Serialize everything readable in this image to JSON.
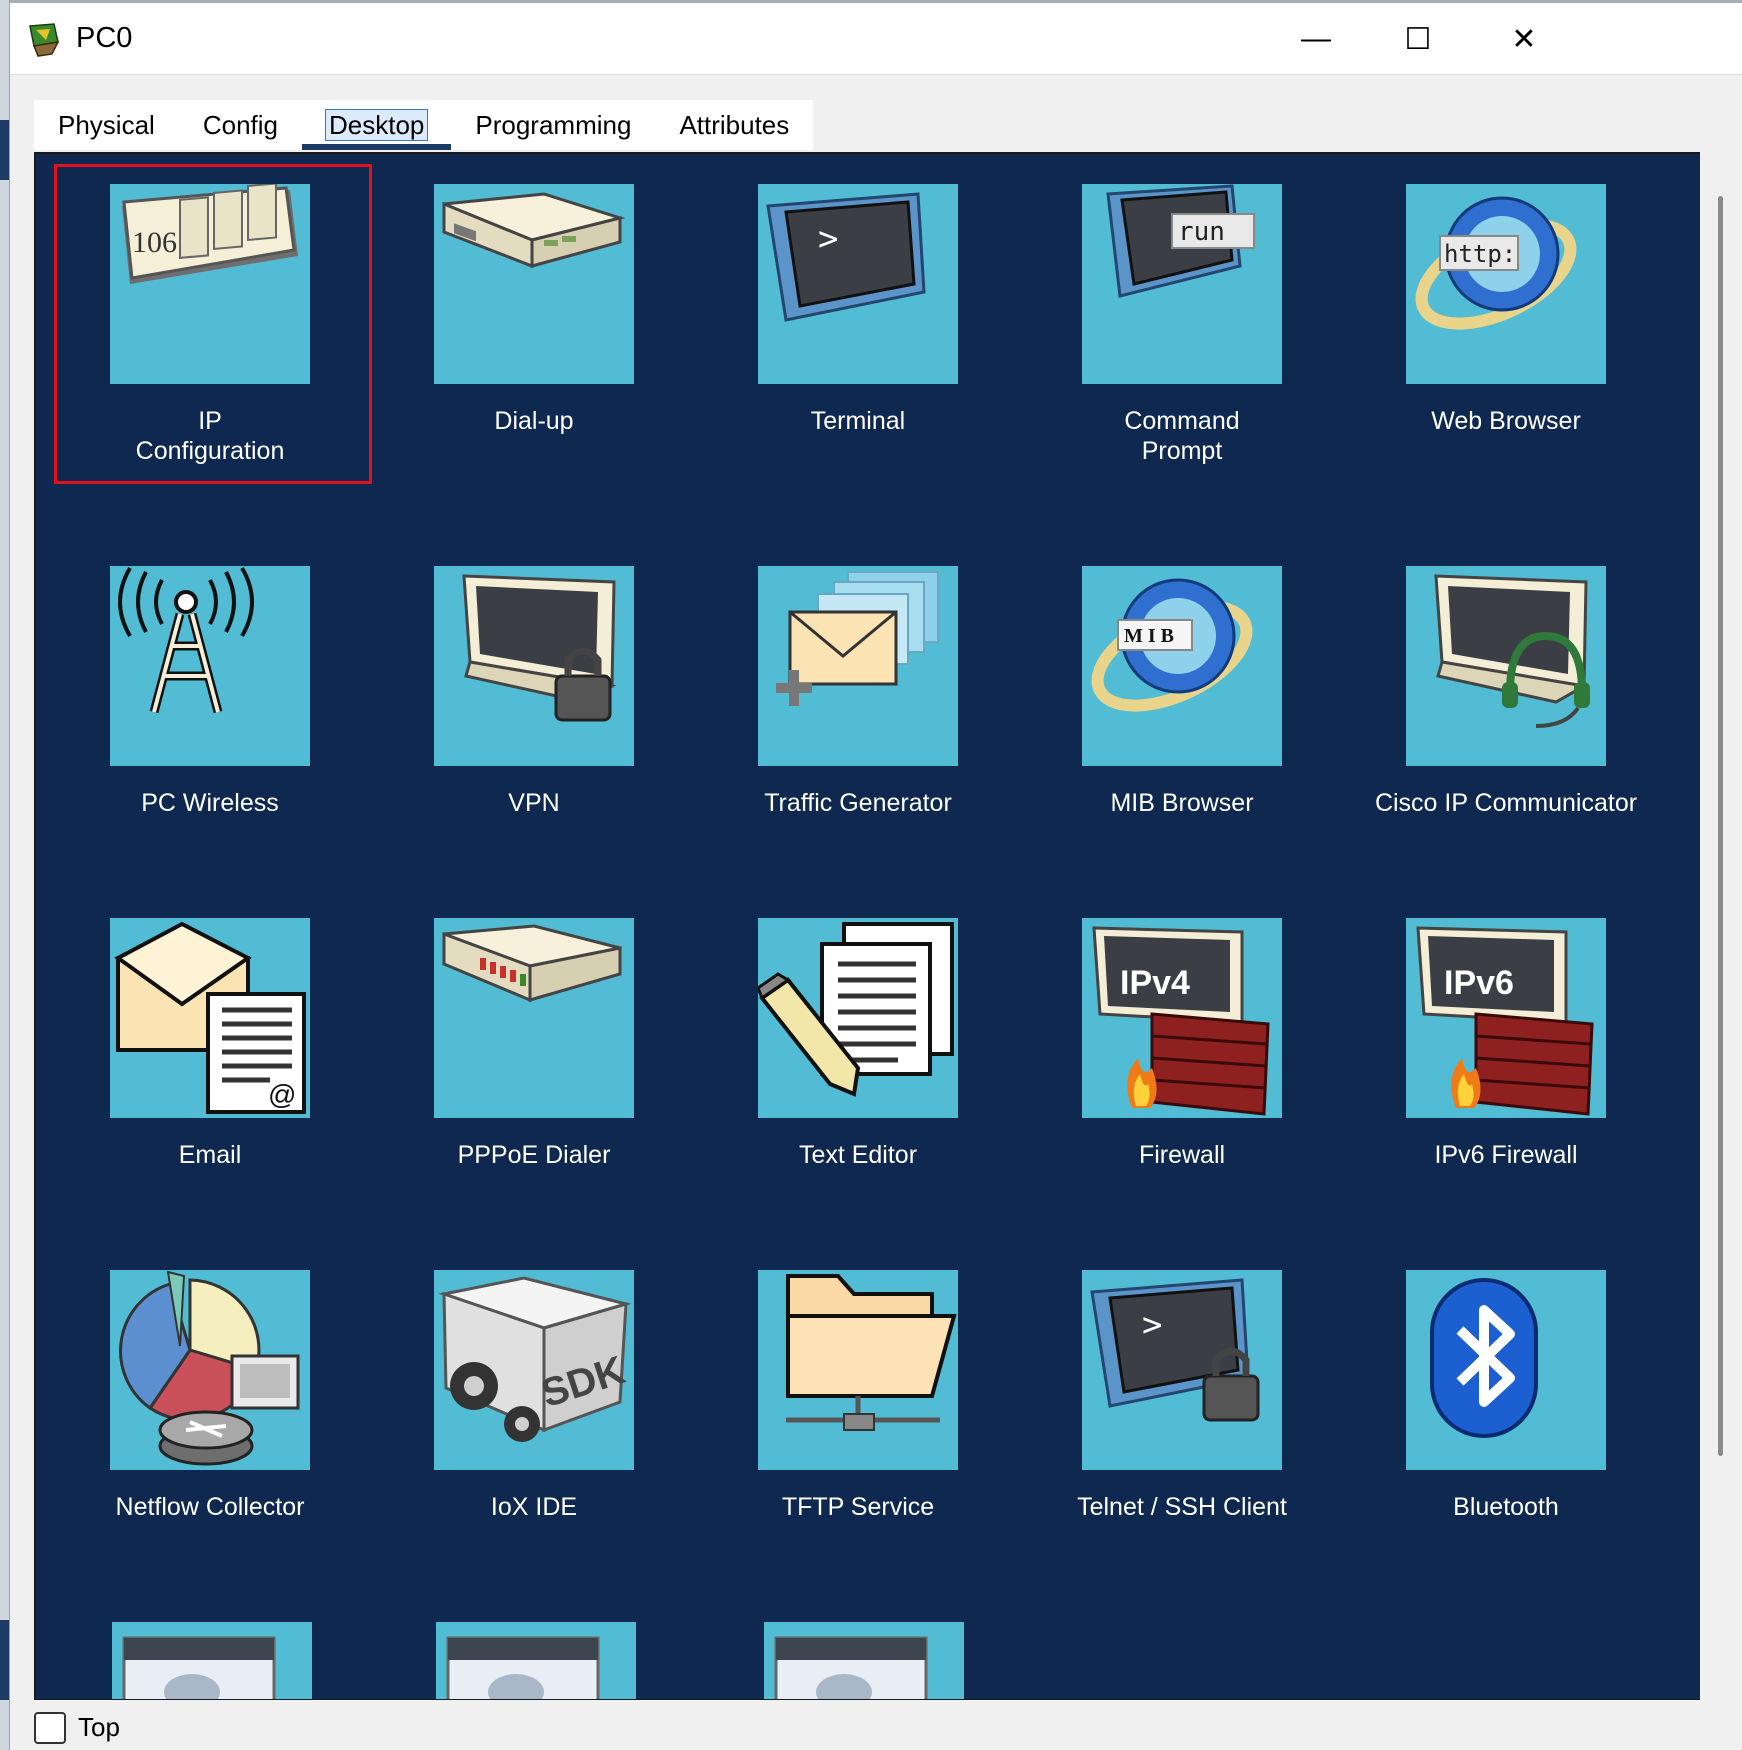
{
  "window": {
    "title": "PC0",
    "minimize": "—",
    "maximize": "☐",
    "close": "✕"
  },
  "tabs": [
    {
      "label": "Physical"
    },
    {
      "label": "Config"
    },
    {
      "label": "Desktop"
    },
    {
      "label": "Programming"
    },
    {
      "label": "Attributes"
    }
  ],
  "apps": [
    {
      "label1": "IP",
      "label2": "Configuration",
      "icon": "ip-configuration-icon"
    },
    {
      "label1": "Dial-up",
      "label2": "",
      "icon": "dial-up-icon"
    },
    {
      "label1": "Terminal",
      "label2": "",
      "icon": "terminal-icon"
    },
    {
      "label1": "Command",
      "label2": "Prompt",
      "icon": "command-prompt-icon"
    },
    {
      "label1": "Web Browser",
      "label2": "",
      "icon": "web-browser-icon"
    },
    {
      "label1": "PC Wireless",
      "label2": "",
      "icon": "pc-wireless-icon"
    },
    {
      "label1": "VPN",
      "label2": "",
      "icon": "vpn-icon"
    },
    {
      "label1": "Traffic Generator",
      "label2": "",
      "icon": "traffic-generator-icon"
    },
    {
      "label1": "MIB Browser",
      "label2": "",
      "icon": "mib-browser-icon"
    },
    {
      "label1": "Cisco IP Communicator",
      "label2": "",
      "icon": "cisco-ip-communicator-icon"
    },
    {
      "label1": "Email",
      "label2": "",
      "icon": "email-icon"
    },
    {
      "label1": "PPPoE Dialer",
      "label2": "",
      "icon": "pppoe-dialer-icon"
    },
    {
      "label1": "Text Editor",
      "label2": "",
      "icon": "text-editor-icon"
    },
    {
      "label1": "Firewall",
      "label2": "",
      "icon": "firewall-icon"
    },
    {
      "label1": "IPv6 Firewall",
      "label2": "",
      "icon": "ipv6-firewall-icon"
    },
    {
      "label1": "Netflow Collector",
      "label2": "",
      "icon": "netflow-collector-icon"
    },
    {
      "label1": "IoX IDE",
      "label2": "",
      "icon": "iox-ide-icon"
    },
    {
      "label1": "TFTP Service",
      "label2": "",
      "icon": "tftp-service-icon"
    },
    {
      "label1": "Telnet / SSH Client",
      "label2": "",
      "icon": "telnet-ssh-client-icon"
    },
    {
      "label1": "Bluetooth",
      "label2": "",
      "icon": "bluetooth-icon"
    }
  ],
  "icon_text": {
    "ip": "106",
    "cmd": "run",
    "web": "http:",
    "mib": "M I B",
    "ipv4": "IPv4",
    "ipv6": "IPv6",
    "sdk": "SDK",
    "prompt": ">",
    "at": "@"
  },
  "bottom": {
    "checkbox_label": "Top"
  },
  "colors": {
    "desktop_bg": "#0f2850",
    "tile_bg": "#52bcd4",
    "selection": "#e0101c"
  }
}
